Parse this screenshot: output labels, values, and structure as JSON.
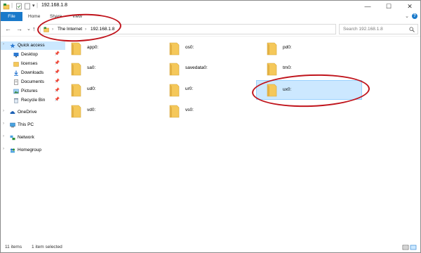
{
  "window": {
    "title": "192.168.1.8"
  },
  "ribbon": {
    "tabs": [
      "File",
      "Home",
      "Share",
      "View"
    ]
  },
  "address": {
    "crumbs": [
      "The Internet",
      "192.168.1.8"
    ],
    "search_placeholder": "Search 192.168.1.8"
  },
  "nav": {
    "items": [
      {
        "label": "Quick access",
        "icon": "star-icon",
        "pinned": false
      },
      {
        "label": "Desktop",
        "icon": "desktop-icon",
        "pinned": true
      },
      {
        "label": "licenses",
        "icon": "folder-icon",
        "pinned": true
      },
      {
        "label": "Downloads",
        "icon": "download-icon",
        "pinned": true
      },
      {
        "label": "Documents",
        "icon": "documents-icon",
        "pinned": true
      },
      {
        "label": "Pictures",
        "icon": "pictures-icon",
        "pinned": true
      },
      {
        "label": "Recycle Bin",
        "icon": "recycle-bin-icon",
        "pinned": true
      },
      {
        "label": "OneDrive",
        "icon": "cloud-icon",
        "pinned": false
      },
      {
        "label": "This PC",
        "icon": "computer-icon",
        "pinned": false
      },
      {
        "label": "Network",
        "icon": "network-icon",
        "pinned": false
      },
      {
        "label": "Homegroup",
        "icon": "homegroup-icon",
        "pinned": false
      }
    ]
  },
  "items": [
    {
      "name": "app0:"
    },
    {
      "name": "os0:"
    },
    {
      "name": "pd0:"
    },
    {
      "name": "sa0:"
    },
    {
      "name": "savedata0:"
    },
    {
      "name": "tm0:"
    },
    {
      "name": "ud0:"
    },
    {
      "name": "ur0:"
    },
    {
      "name": "ux0:"
    },
    {
      "name": "vd0:"
    },
    {
      "name": "vs0:"
    }
  ],
  "selected_item": "ux0:",
  "status": {
    "count": "11 items",
    "selection": "1 item selected"
  },
  "colors": {
    "accent": "#1979ca",
    "selection": "#cce8ff",
    "folder": "#f5c85a",
    "annotation": "#c0141c"
  }
}
